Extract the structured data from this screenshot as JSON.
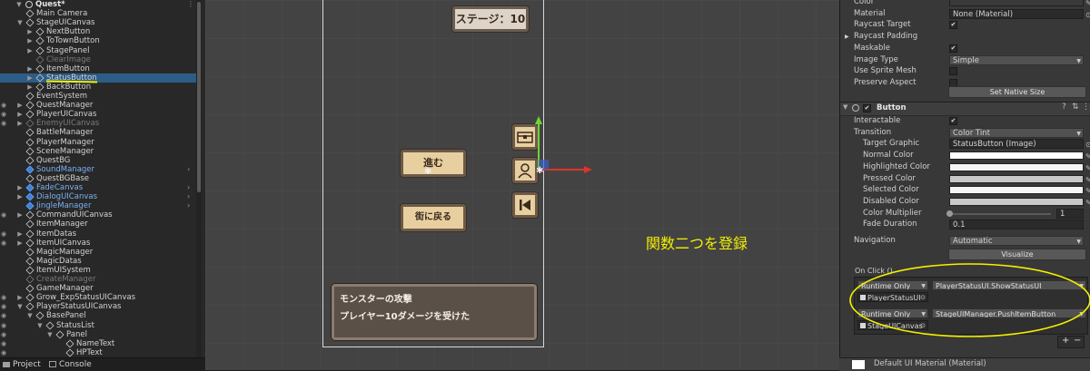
{
  "hierarchy": {
    "scene_name": "Quest*",
    "items": [
      {
        "label": "Main Camera",
        "indent": 2,
        "arrow": "",
        "icon": "go",
        "style": "",
        "eye": false,
        "chev": false
      },
      {
        "label": "StageUICanvas",
        "indent": 2,
        "arrow": "▼",
        "icon": "go",
        "style": "",
        "eye": false,
        "chev": false
      },
      {
        "label": "NextButton",
        "indent": 3,
        "arrow": "▶",
        "icon": "go",
        "style": "",
        "eye": false,
        "chev": false
      },
      {
        "label": "ToTownButton",
        "indent": 3,
        "arrow": "▶",
        "icon": "go",
        "style": "",
        "eye": false,
        "chev": false
      },
      {
        "label": "StagePanel",
        "indent": 3,
        "arrow": "▶",
        "icon": "go",
        "style": "",
        "eye": false,
        "chev": false
      },
      {
        "label": "ClearImage",
        "indent": 3,
        "arrow": "",
        "icon": "go",
        "style": "dim",
        "eye": false,
        "chev": false
      },
      {
        "label": "ItemButton",
        "indent": 3,
        "arrow": "▶",
        "icon": "go",
        "style": "",
        "eye": false,
        "chev": false
      },
      {
        "label": "StatusButton",
        "indent": 3,
        "arrow": "▶",
        "icon": "go",
        "style": "",
        "eye": false,
        "chev": false
      },
      {
        "label": "BackButton",
        "indent": 3,
        "arrow": "▶",
        "icon": "go",
        "style": "",
        "eye": false,
        "chev": false
      },
      {
        "label": "EventSystem",
        "indent": 2,
        "arrow": "",
        "icon": "go",
        "style": "",
        "eye": false,
        "chev": false
      },
      {
        "label": "QuestManager",
        "indent": 2,
        "arrow": "▶",
        "icon": "go",
        "style": "",
        "eye": true,
        "chev": false
      },
      {
        "label": "PlayerUICanvas",
        "indent": 2,
        "arrow": "▶",
        "icon": "go",
        "style": "",
        "eye": true,
        "chev": false
      },
      {
        "label": "EnemyUICanvas",
        "indent": 2,
        "arrow": "▶",
        "icon": "go",
        "style": "dim",
        "eye": true,
        "chev": false
      },
      {
        "label": "BattleManager",
        "indent": 2,
        "arrow": "",
        "icon": "go",
        "style": "",
        "eye": false,
        "chev": false
      },
      {
        "label": "PlayerManager",
        "indent": 2,
        "arrow": "",
        "icon": "go",
        "style": "",
        "eye": false,
        "chev": false
      },
      {
        "label": "SceneManager",
        "indent": 2,
        "arrow": "",
        "icon": "go",
        "style": "",
        "eye": false,
        "chev": false
      },
      {
        "label": "QuestBG",
        "indent": 2,
        "arrow": "",
        "icon": "go",
        "style": "",
        "eye": false,
        "chev": false
      },
      {
        "label": "SoundManager",
        "indent": 2,
        "arrow": "",
        "icon": "prefab",
        "style": "prefab",
        "eye": false,
        "chev": true
      },
      {
        "label": "QuestBGBase",
        "indent": 2,
        "arrow": "",
        "icon": "go",
        "style": "",
        "eye": false,
        "chev": false
      },
      {
        "label": "FadeCanvas",
        "indent": 2,
        "arrow": "▶",
        "icon": "prefab",
        "style": "prefab",
        "eye": false,
        "chev": true
      },
      {
        "label": "DialogUICanvas",
        "indent": 2,
        "arrow": "▶",
        "icon": "prefab",
        "style": "prefab",
        "eye": false,
        "chev": true
      },
      {
        "label": "JingleManager",
        "indent": 2,
        "arrow": "",
        "icon": "prefab",
        "style": "prefab",
        "eye": false,
        "chev": true
      },
      {
        "label": "CommandUICanvas",
        "indent": 2,
        "arrow": "▶",
        "icon": "go",
        "style": "",
        "eye": true,
        "chev": false
      },
      {
        "label": "ItemManager",
        "indent": 2,
        "arrow": "",
        "icon": "go",
        "style": "",
        "eye": false,
        "chev": false
      },
      {
        "label": "ItemDatas",
        "indent": 2,
        "arrow": "▶",
        "icon": "go",
        "style": "",
        "eye": true,
        "chev": false
      },
      {
        "label": "ItemUICanvas",
        "indent": 2,
        "arrow": "▶",
        "icon": "go",
        "style": "",
        "eye": true,
        "chev": false
      },
      {
        "label": "MagicManager",
        "indent": 2,
        "arrow": "",
        "icon": "go",
        "style": "",
        "eye": false,
        "chev": false
      },
      {
        "label": "MagicDatas",
        "indent": 2,
        "arrow": "",
        "icon": "go",
        "style": "",
        "eye": false,
        "chev": false
      },
      {
        "label": "ItemUISystem",
        "indent": 2,
        "arrow": "",
        "icon": "go",
        "style": "",
        "eye": false,
        "chev": false
      },
      {
        "label": "CreateManager",
        "indent": 2,
        "arrow": "",
        "icon": "go",
        "style": "dim",
        "eye": false,
        "chev": false
      },
      {
        "label": "GameManager",
        "indent": 2,
        "arrow": "",
        "icon": "go",
        "style": "",
        "eye": false,
        "chev": false
      },
      {
        "label": "Grow_ExpStatusUICanvas",
        "indent": 2,
        "arrow": "▶",
        "icon": "go",
        "style": "",
        "eye": true,
        "chev": false
      },
      {
        "label": "PlayerStatusUICanvas",
        "indent": 2,
        "arrow": "▼",
        "icon": "go",
        "style": "",
        "eye": true,
        "chev": false
      },
      {
        "label": "BasePanel",
        "indent": 3,
        "arrow": "▼",
        "icon": "go",
        "style": "",
        "eye": true,
        "chev": false
      },
      {
        "label": "StatusList",
        "indent": 4,
        "arrow": "▼",
        "icon": "go",
        "style": "",
        "eye": true,
        "chev": false
      },
      {
        "label": "Panel",
        "indent": 5,
        "arrow": "▼",
        "icon": "go",
        "style": "",
        "eye": true,
        "chev": false
      },
      {
        "label": "NameText",
        "indent": 6,
        "arrow": "",
        "icon": "go",
        "style": "",
        "eye": true,
        "chev": false
      },
      {
        "label": "HPText",
        "indent": 6,
        "arrow": "",
        "icon": "go",
        "style": "",
        "eye": true,
        "chev": false
      }
    ],
    "selected_index": 7
  },
  "bottom_tabs": {
    "project": "Project",
    "console": "Console"
  },
  "scene": {
    "stage_label": "ステージ：10",
    "btn_next": "進む",
    "btn_town": "街に戻る",
    "message_line1": "モンスターの攻撃",
    "message_line2": "プレイヤー10ダメージを受けた",
    "annotation": "関数二つを登録"
  },
  "inspector": {
    "top_rows": [
      {
        "label": "Color",
        "type": "color",
        "value": ""
      },
      {
        "label": "Material",
        "type": "field",
        "value": "None (Material)"
      },
      {
        "label": "Raycast Target",
        "type": "check",
        "value": "✔"
      },
      {
        "label": "Raycast Padding",
        "type": "fold",
        "value": ""
      },
      {
        "label": "Maskable",
        "type": "check",
        "value": "✔"
      },
      {
        "label": "Image Type",
        "type": "dropdown",
        "value": "Simple"
      },
      {
        "label": "Use Sprite Mesh",
        "type": "check",
        "value": ""
      },
      {
        "label": "Preserve Aspect",
        "type": "check",
        "value": ""
      }
    ],
    "set_native_size": "Set Native Size",
    "button_component": "Button",
    "button_rows": [
      {
        "label": "Interactable",
        "type": "check",
        "value": "✔",
        "sub": false
      },
      {
        "label": "Transition",
        "type": "dropdown",
        "value": "Color Tint",
        "sub": false
      },
      {
        "label": "Target Graphic",
        "type": "field",
        "value": "StatusButton (Image)",
        "sub": true
      },
      {
        "label": "Normal Color",
        "type": "color",
        "value": "#ffffff",
        "sub": true
      },
      {
        "label": "Highlighted Color",
        "type": "color",
        "value": "#f5f5f5",
        "sub": true
      },
      {
        "label": "Pressed Color",
        "type": "color",
        "value": "#c8c8c8",
        "sub": true
      },
      {
        "label": "Selected Color",
        "type": "color",
        "value": "#f5f5f5",
        "sub": true
      },
      {
        "label": "Disabled Color",
        "type": "color",
        "value": "#c8c8c8",
        "sub": true
      },
      {
        "label": "Color Multiplier",
        "type": "slider",
        "value": "1",
        "sub": true
      },
      {
        "label": "Fade Duration",
        "type": "field",
        "value": "0.1",
        "sub": true
      }
    ],
    "color_multiplier_fraction": 0.0,
    "navigation_label": "Navigation",
    "navigation_value": "Automatic",
    "visualize": "Visualize",
    "onclick_title": "On Click ()",
    "onclick_entries": [
      {
        "mode": "Runtime Only",
        "function": "PlayerStatusUI.ShowStatusUI",
        "object": "PlayerStatusUI"
      },
      {
        "mode": "Runtime Only",
        "function": "StageUIManager.PushItemButton",
        "object": "StageUICanvas"
      }
    ],
    "plus": "+",
    "minus": "−",
    "material_footer": "Default UI Material (Material)"
  },
  "colors": {
    "selection": "#2c5d87",
    "highlight": "#f4f000",
    "prefab_text": "#7cb0f3"
  }
}
